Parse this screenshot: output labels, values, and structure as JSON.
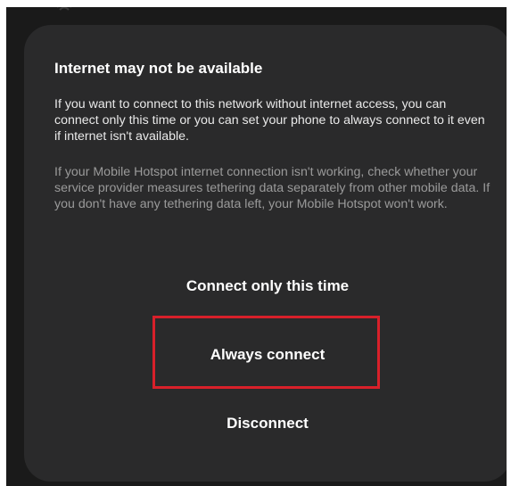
{
  "dialog": {
    "title": "Internet may not be available",
    "message_primary": "If you want to connect to this network without internet access, you can connect only this time or you can set your phone to always connect to it even if internet isn't available.",
    "message_secondary": "If your Mobile Hotspot internet connection isn't working, check whether your service provider measures tethering data separately from other mobile data. If you don't have any tethering data left, your Mobile Hotspot won't work.",
    "actions": [
      {
        "label": "Connect only this time"
      },
      {
        "label": "Always connect"
      },
      {
        "label": "Disconnect"
      }
    ]
  },
  "colors": {
    "background": "#1a1a1a",
    "dialog_surface": "#2a2a2b",
    "highlight_outline": "#d8202a"
  }
}
